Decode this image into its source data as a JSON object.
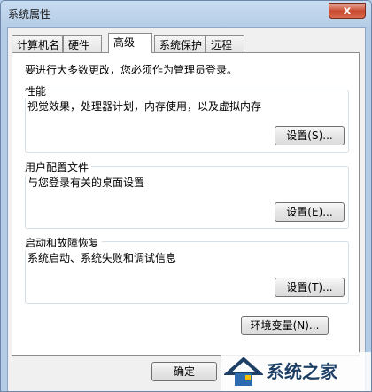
{
  "window": {
    "title": "系统属性",
    "close_glyph": "x"
  },
  "tabs": [
    {
      "label": "计算机名",
      "active": false
    },
    {
      "label": "硬件",
      "active": false
    },
    {
      "label": "高级",
      "active": true
    },
    {
      "label": "系统保护",
      "active": false
    },
    {
      "label": "远程",
      "active": false
    }
  ],
  "notice": "要进行大多数更改，您必须作为管理员登录。",
  "groups": {
    "performance": {
      "title": "性能",
      "desc": "视觉效果，处理器计划，内存使用，以及虚拟内存",
      "button": "设置(S)..."
    },
    "profile": {
      "title": "用户配置文件",
      "desc": "与您登录有关的桌面设置",
      "button": "设置(E)..."
    },
    "startup": {
      "title": "启动和故障恢复",
      "desc": "系统启动、系统失败和调试信息",
      "button": "设置(T)..."
    }
  },
  "env_button": "环境变量(N)...",
  "ok_button": "确定",
  "watermark": {
    "text": "系统之家"
  },
  "colors": {
    "accent": "#1e3f66",
    "close": "#c7472c"
  }
}
